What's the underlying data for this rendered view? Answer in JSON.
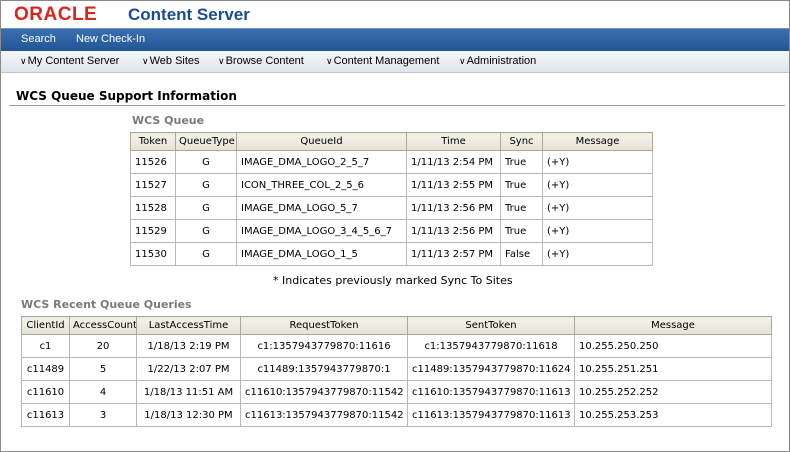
{
  "header": {
    "logo_text": "ORACLE",
    "product_name": "Content Server"
  },
  "topnav": {
    "search": "Search",
    "new_checkin": "New Check-In"
  },
  "menus": [
    "My Content Server",
    "Web Sites",
    "Browse Content",
    "Content Management",
    "Administration"
  ],
  "page": {
    "title": "WCS Queue Support Information"
  },
  "queue": {
    "title": "WCS Queue",
    "headers": [
      "Token",
      "QueueType",
      "QueueId",
      "Time",
      "Sync",
      "Message"
    ],
    "rows": [
      [
        "11526",
        "G",
        "IMAGE_DMA_LOGO_2_5_7",
        "1/11/13 2:54 PM",
        "True",
        "(+Y)"
      ],
      [
        "11527",
        "G",
        "ICON_THREE_COL_2_5_6",
        "1/11/13 2:55 PM",
        "True",
        "(+Y)"
      ],
      [
        "11528",
        "G",
        "IMAGE_DMA_LOGO_5_7",
        "1/11/13 2:56 PM",
        "True",
        "(+Y)"
      ],
      [
        "11529",
        "G",
        "IMAGE_DMA_LOGO_3_4_5_6_7",
        "1/11/13 2:56 PM",
        "True",
        "(+Y)"
      ],
      [
        "11530",
        "G",
        "IMAGE_DMA_LOGO_1_5",
        "1/11/13 2:57 PM",
        "False",
        "(+Y)"
      ]
    ],
    "note": "* Indicates previously marked Sync To Sites"
  },
  "recent": {
    "title": "WCS Recent Queue Queries",
    "headers": [
      "ClientId",
      "AccessCount",
      "LastAccessTime",
      "RequestToken",
      "SentToken",
      "Message"
    ],
    "rows": [
      [
        "c1",
        "20",
        "1/18/13 2:19 PM",
        "c1:1357943779870:11616",
        "c1:1357943779870:11618",
        "10.255.250.250"
      ],
      [
        "c11489",
        "5",
        "1/22/13 2:07 PM",
        "c11489:1357943779870:1",
        "c11489:1357943779870:11624",
        "10.255.251.251"
      ],
      [
        "c11610",
        "4",
        "1/18/13 11:51 AM",
        "c11610:1357943779870:11542",
        "c11610:1357943779870:11613",
        "10.255.252.252"
      ],
      [
        "c11613",
        "3",
        "1/18/13 12:30 PM",
        "c11613:1357943779870:11542",
        "c11613:1357943779870:11613",
        "10.255.253.253"
      ]
    ]
  }
}
